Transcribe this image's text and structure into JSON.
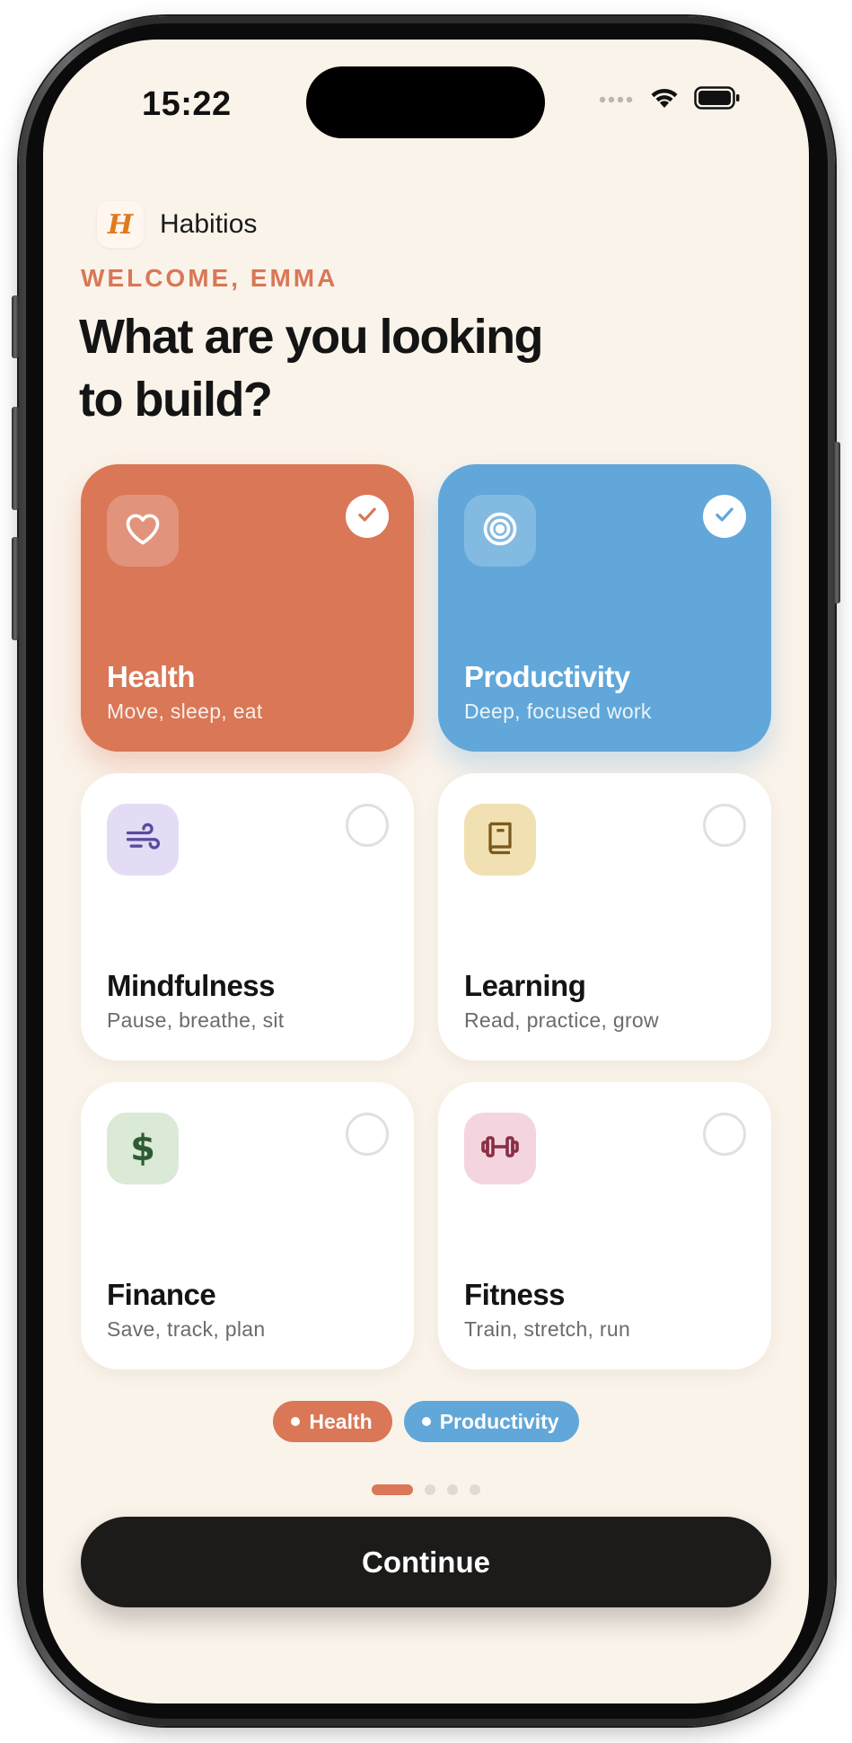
{
  "status_bar": {
    "time": "15:22",
    "icons": [
      "signal-dots-icon",
      "wifi-icon",
      "battery-icon"
    ]
  },
  "brand": {
    "logo_text": "H",
    "name": "Habitios"
  },
  "welcome": "WELCOME, EMMA",
  "headline": "What are you looking to build?",
  "categories": [
    {
      "title": "Health",
      "subtitle": "Move, sleep, eat",
      "icon": "heart-icon",
      "selected": true,
      "color": "#d97756"
    },
    {
      "title": "Productivity",
      "subtitle": "Deep, focused work",
      "icon": "target-icon",
      "selected": true,
      "color": "#61a7d9"
    },
    {
      "title": "Mindfulness",
      "subtitle": "Pause, breathe, sit",
      "icon": "wind-icon",
      "selected": false,
      "color": "#e4dcf5"
    },
    {
      "title": "Learning",
      "subtitle": "Read, practice, grow",
      "icon": "book-icon",
      "selected": false,
      "color": "#f1e0b1"
    },
    {
      "title": "Finance",
      "subtitle": "Save, track, plan",
      "icon": "dollar-icon",
      "selected": false,
      "color": "#dbe9d7"
    },
    {
      "title": "Fitness",
      "subtitle": "Train, stretch, run",
      "icon": "dumbbell-icon",
      "selected": false,
      "color": "#f4d5df"
    }
  ],
  "selected_chips": [
    {
      "label": "Health",
      "color": "#d97756"
    },
    {
      "label": "Productivity",
      "color": "#61a7d9"
    }
  ],
  "pager": {
    "pages": 4,
    "current": 1
  },
  "continue_label": "Continue"
}
